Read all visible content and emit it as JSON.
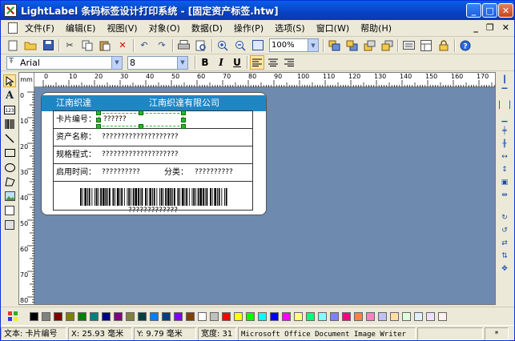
{
  "window": {
    "title": "LightLabel 条码标签设计打印系统 - [固定资产标签.htw]",
    "min": "_",
    "max": "□",
    "close": "✕"
  },
  "menu": [
    "文件(F)",
    "编辑(E)",
    "视图(V)",
    "对象(O)",
    "数据(D)",
    "操作(P)",
    "选项(S)",
    "窗口(W)",
    "帮助(H)"
  ],
  "mdi": {
    "min": "_",
    "restore": "❐",
    "close": "✕"
  },
  "toolbar": {
    "zoom": "100%"
  },
  "font": {
    "name": "Arial",
    "size": "8",
    "bold": "B",
    "italic": "I",
    "underline": "U"
  },
  "ruler": {
    "unit": "mm",
    "h_ticks": [
      "0",
      "10",
      "20",
      "30",
      "40",
      "50",
      "60",
      "70",
      "80",
      "90",
      "100",
      "110",
      "120",
      "130",
      "140",
      "150",
      "160",
      "170"
    ],
    "v_ticks": [
      "0",
      "10",
      "20",
      "30",
      "40",
      "50",
      "60",
      "70",
      "80"
    ]
  },
  "label": {
    "header_left": "江南织達",
    "header_right": "江南织達有限公司",
    "rows": {
      "card_no": {
        "label": "卡片编号：",
        "value": "??????"
      },
      "asset_name": {
        "label": "资产名称：",
        "value": "????????????????????"
      },
      "spec": {
        "label": "规格程式：",
        "value": "????????????????????"
      },
      "start_date": {
        "label": "启用时间：",
        "value": "??????????"
      },
      "category": {
        "label": "分类：",
        "value": "??????????"
      }
    },
    "barcode_text": "?????????????"
  },
  "palette": [
    "#000000",
    "#808080",
    "#800000",
    "#808000",
    "#008000",
    "#008080",
    "#000080",
    "#800080",
    "#808040",
    "#004040",
    "#0080ff",
    "#004080",
    "#8000ff",
    "#804000",
    "#ffffff",
    "#c0c0c0",
    "#ff0000",
    "#ffff00",
    "#00ff00",
    "#00ffff",
    "#0000ff",
    "#ff00ff",
    "#ffff80",
    "#00ff80",
    "#80ffff",
    "#8080ff",
    "#ff0080",
    "#ff8040",
    "#ff80c0",
    "#c0c0ff",
    "#ffe0a0",
    "#e0ffe0",
    "#e0f0ff",
    "#f0e0ff",
    "#fff0f0"
  ],
  "status": {
    "object": "文本: 卡片编号",
    "x": "X: 25.93 毫米",
    "y": "Y: 9.79 毫米",
    "width": "宽度: 31",
    "printer": "Microsoft Office Document Image Writer",
    "extra": "*"
  }
}
